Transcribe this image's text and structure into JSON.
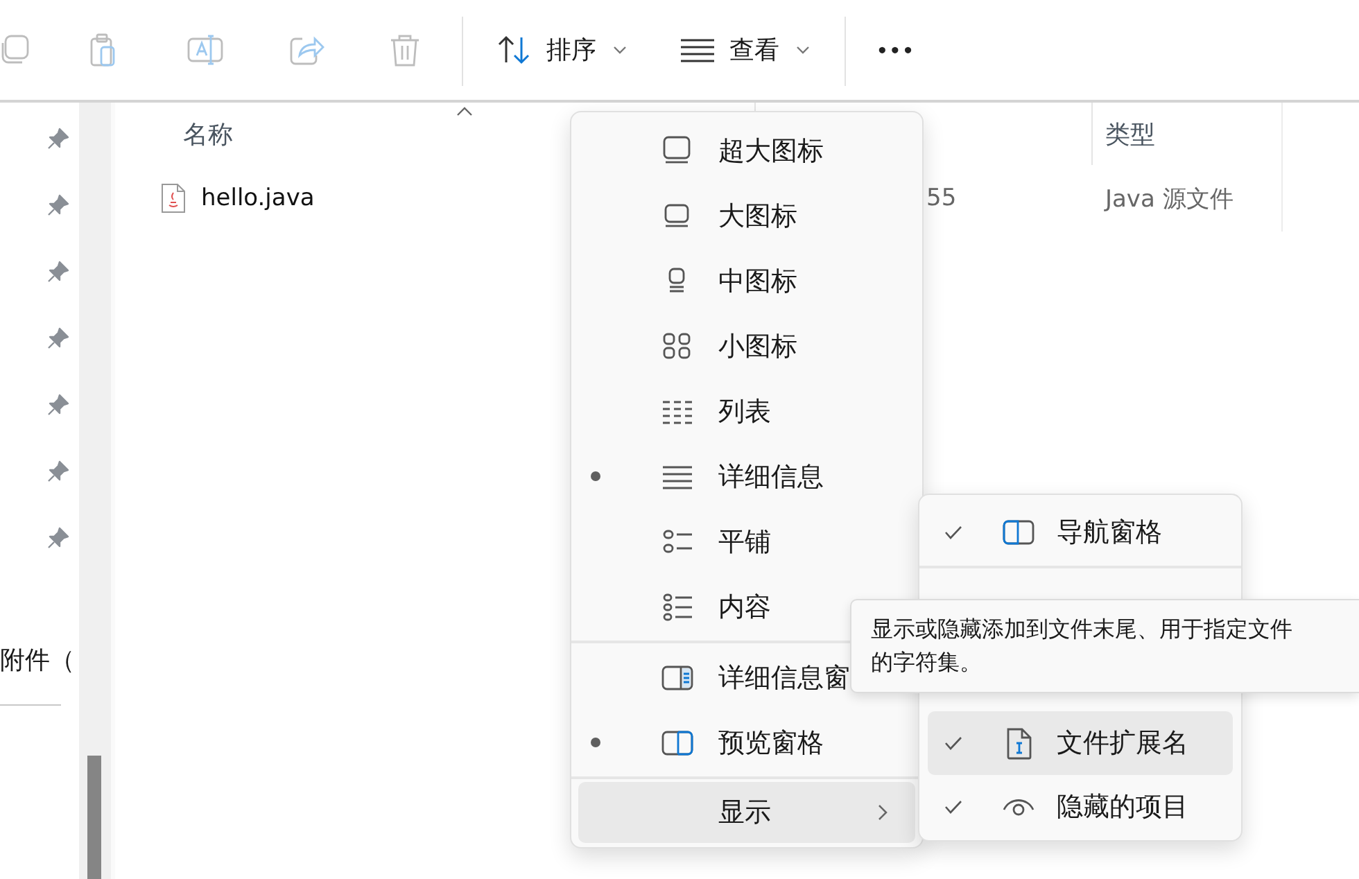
{
  "toolbar": {
    "actions": [
      {
        "kind": "copy",
        "disabled": true
      },
      {
        "kind": "paste",
        "disabled": true
      },
      {
        "kind": "rename",
        "disabled": true
      },
      {
        "kind": "share",
        "disabled": true
      },
      {
        "kind": "delete",
        "disabled": true
      }
    ],
    "sort": {
      "label": "排序"
    },
    "view": {
      "label": "查看"
    },
    "more": {
      "label": "•••"
    }
  },
  "sidebar": {
    "items": [
      {
        "kind": "pin"
      },
      {
        "kind": "pin"
      },
      {
        "kind": "pin"
      },
      {
        "kind": "pin"
      },
      {
        "kind": "pin"
      },
      {
        "kind": "pin"
      },
      {
        "kind": "pin"
      },
      {
        "kind": "label",
        "label": "附件（"
      }
    ]
  },
  "file_list": {
    "columns": [
      {
        "label": "名称",
        "sorted": true
      },
      {
        "label": "类型",
        "sorted": false
      }
    ],
    "rows": [
      {
        "name": "hello.java",
        "column_2": "55",
        "type": "Java 源文件"
      }
    ]
  },
  "view_menu": {
    "layouts": [
      {
        "label": "超大图标",
        "selected": false
      },
      {
        "label": "大图标",
        "selected": false
      },
      {
        "label": "中图标",
        "selected": false
      },
      {
        "label": "小图标",
        "selected": false
      },
      {
        "label": "列表",
        "selected": false
      },
      {
        "label": "详细信息",
        "selected": true
      },
      {
        "label": "平铺",
        "selected": false
      },
      {
        "label": "内容",
        "selected": false
      }
    ],
    "panes": [
      {
        "label": "详细信息窗",
        "checked": false
      },
      {
        "label": "预览窗格",
        "checked": true
      }
    ],
    "show": {
      "label": "显示",
      "expanded": true
    }
  },
  "show_menu": {
    "sections": [
      [
        {
          "label": "导航窗格",
          "checked": true,
          "hovered": false
        }
      ],
      [
        {
          "label": "文件扩展名",
          "checked": true,
          "hovered": true
        },
        {
          "label": "隐藏的项目",
          "checked": true,
          "hovered": false
        }
      ]
    ]
  },
  "tooltip": {
    "lines": [
      "显示或隐藏添加到文件末尾、用于指定文件",
      "的字符集。"
    ]
  }
}
